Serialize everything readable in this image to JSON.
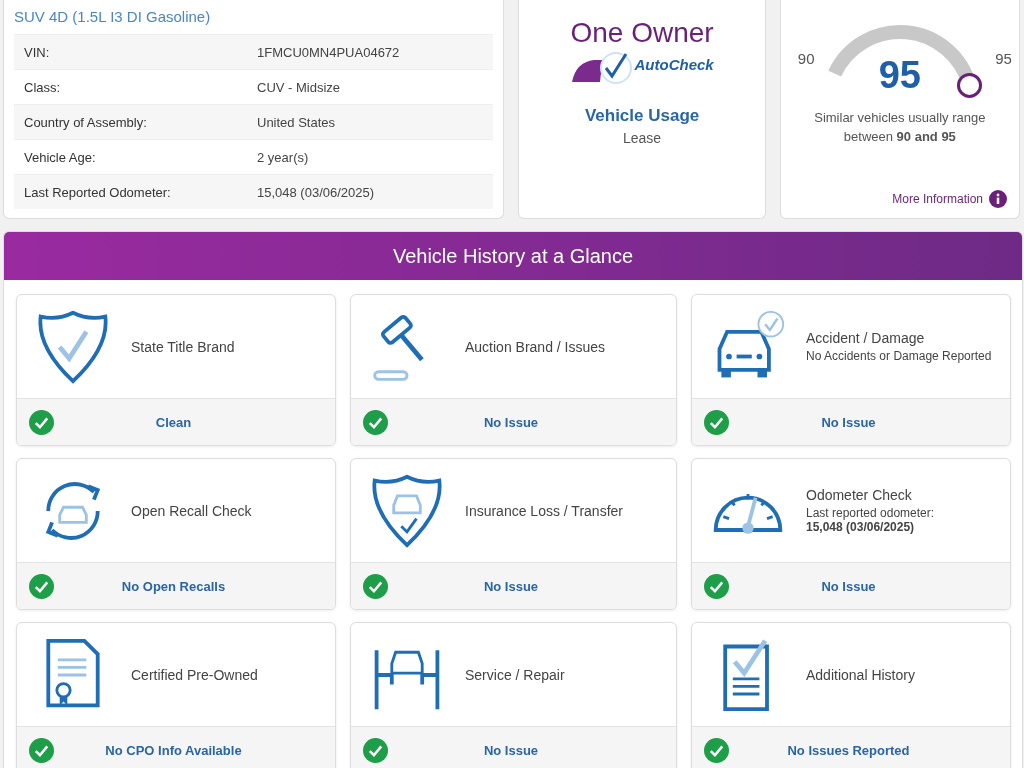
{
  "vehicle": {
    "subtitle": "SUV 4D (1.5L I3 DI Gasoline)",
    "specs": [
      {
        "label": "VIN:",
        "value": "1FMCU0MN4PUA04672"
      },
      {
        "label": "Class:",
        "value": "CUV - Midsize"
      },
      {
        "label": "Country of Assembly:",
        "value": "United States"
      },
      {
        "label": "Vehicle Age:",
        "value": "2 year(s)"
      },
      {
        "label": "Last Reported Odometer:",
        "value": "15,048 (03/06/2025)"
      }
    ]
  },
  "owner": {
    "logo_title": "One Owner",
    "logo_brand": "AutoCheck",
    "usage_label": "Vehicle Usage",
    "usage_value": "Lease"
  },
  "score": {
    "min": "90",
    "max": "95",
    "value": "95",
    "description": "Similar vehicles usually range between **90 and 95**",
    "more_link": "More Information"
  },
  "glance": {
    "title": "Vehicle History at a Glance",
    "tiles": [
      {
        "kind": "shield",
        "title": "State Title Brand",
        "passed": true,
        "status": "Clean"
      },
      {
        "kind": "gavel",
        "title": "Auction Brand / Issues",
        "passed": true,
        "status": "No Issue"
      },
      {
        "kind": "car",
        "title": "Accident / Damage",
        "subtitle": "No Accidents or Damage Reported",
        "passed": true,
        "status": "No Issue"
      },
      {
        "kind": "recall",
        "title": "Open Recall Check",
        "passed": true,
        "status": "No Open Recalls"
      },
      {
        "kind": "insurance",
        "title": "Insurance Loss / Transfer",
        "passed": true,
        "status": "No Issue"
      },
      {
        "kind": "odometer",
        "title": "Odometer Check",
        "subtitle": "Last reported odometer:",
        "detail": "15,048 (03/06/2025)",
        "passed": true,
        "status": "No Issue"
      },
      {
        "kind": "certificate",
        "title": "Certified Pre-Owned",
        "passed": true,
        "status": "No CPO Info Available"
      },
      {
        "kind": "lift",
        "title": "Service / Repair",
        "passed": true,
        "status": "No Issue"
      },
      {
        "kind": "document",
        "title": "Additional History",
        "passed": true,
        "status": "No Issues Reported"
      }
    ]
  }
}
